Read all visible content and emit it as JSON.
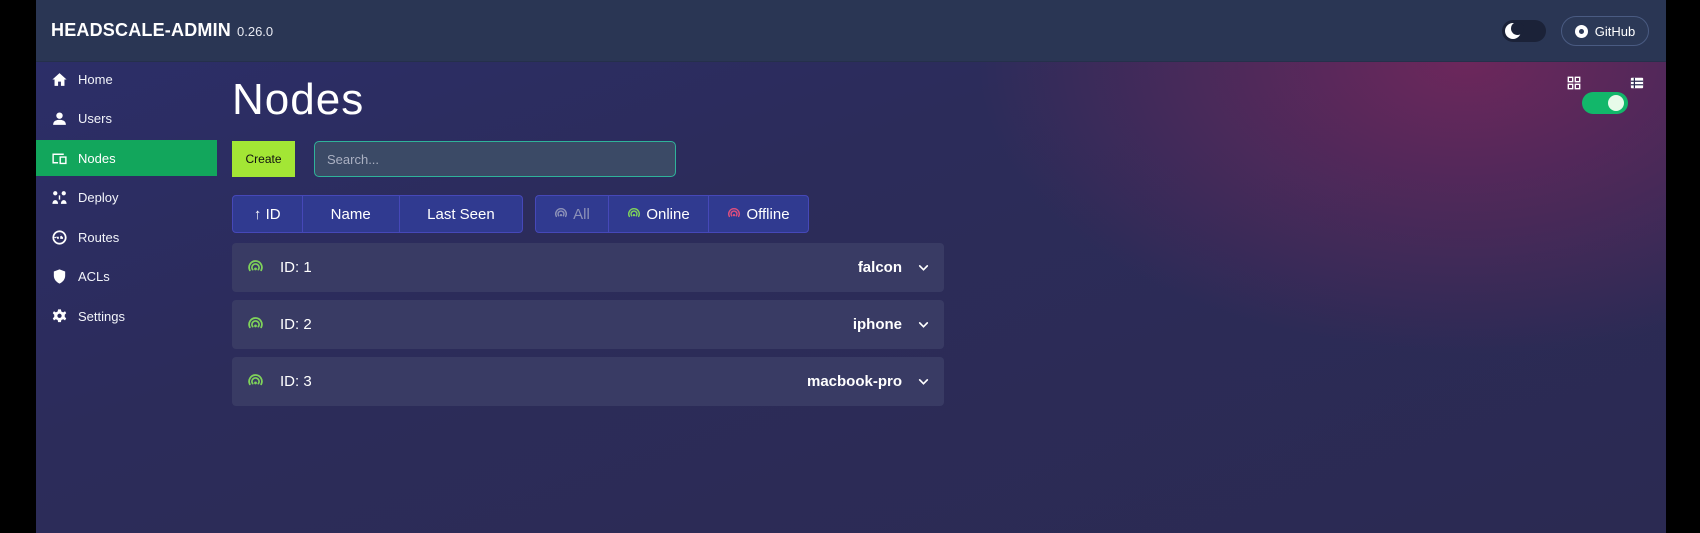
{
  "app": {
    "name": "HEADSCALE-ADMIN",
    "version": "0.26.0"
  },
  "header": {
    "github_label": "GitHub"
  },
  "sidebar": {
    "items": [
      {
        "label": "Home",
        "icon": "home-icon"
      },
      {
        "label": "Users",
        "icon": "user-icon"
      },
      {
        "label": "Nodes",
        "icon": "devices-icon",
        "active": true
      },
      {
        "label": "Deploy",
        "icon": "deploy-icon"
      },
      {
        "label": "Routes",
        "icon": "routes-icon"
      },
      {
        "label": "ACLs",
        "icon": "shield-icon"
      },
      {
        "label": "Settings",
        "icon": "gear-icon"
      }
    ]
  },
  "page": {
    "title": "Nodes",
    "create_label": "Create",
    "search_placeholder": "Search...",
    "search_value": ""
  },
  "sort": {
    "id_label": "↑ ID",
    "name_label": "Name",
    "last_seen_label": "Last Seen"
  },
  "filter": {
    "all_label": "All",
    "online_label": "Online",
    "offline_label": "Offline"
  },
  "nodes": [
    {
      "id_text": "ID: 1",
      "name": "falcon",
      "status": "online"
    },
    {
      "id_text": "ID: 2",
      "name": "iphone",
      "status": "online"
    },
    {
      "id_text": "ID: 3",
      "name": "macbook-pro",
      "status": "online"
    }
  ],
  "view": {
    "mode": "list",
    "toggle_on": true
  },
  "colors": {
    "accent_green": "#12a65c",
    "create_button": "#a3e635",
    "online": "#7fd35a",
    "offline": "#e04f7d",
    "topbar": "#2a3654"
  }
}
